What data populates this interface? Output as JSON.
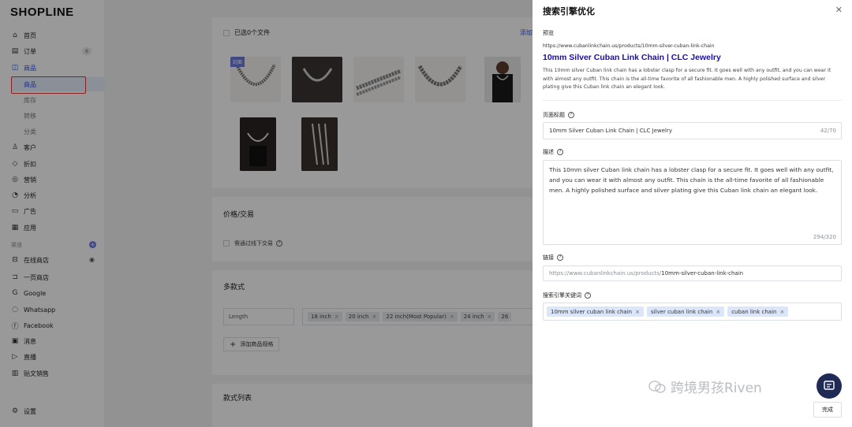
{
  "logo": "SHOPLINE",
  "sidebar": {
    "items": [
      {
        "label": "首页",
        "icon": "home-icon"
      },
      {
        "label": "订单",
        "icon": "order-icon",
        "badge": "6"
      },
      {
        "label": "商品",
        "icon": "bag-icon"
      },
      {
        "label": "商品",
        "icon": ""
      },
      {
        "label": "库存",
        "icon": ""
      },
      {
        "label": "转移",
        "icon": ""
      },
      {
        "label": "分类",
        "icon": ""
      },
      {
        "label": "客户",
        "icon": "user-icon"
      },
      {
        "label": "折扣",
        "icon": "tag-icon"
      },
      {
        "label": "营销",
        "icon": "marketing-icon"
      },
      {
        "label": "分析",
        "icon": "analytics-icon"
      },
      {
        "label": "广告",
        "icon": "ads-icon"
      },
      {
        "label": "应用",
        "icon": "apps-icon"
      }
    ],
    "channels_label": "渠道",
    "channels": [
      {
        "label": "在线商店",
        "icon": "store-icon"
      },
      {
        "label": "一页商店",
        "icon": "page-store-icon"
      },
      {
        "label": "Google",
        "icon": "google-icon"
      },
      {
        "label": "Whatsapp",
        "icon": "whatsapp-icon"
      },
      {
        "label": "Facebook",
        "icon": "facebook-icon"
      },
      {
        "label": "消息",
        "icon": "message-icon"
      },
      {
        "label": "直播",
        "icon": "live-icon"
      },
      {
        "label": "贴文销售",
        "icon": "post-sale-icon"
      }
    ],
    "settings": "设置"
  },
  "main": {
    "files_selected": "已选0个文件",
    "add_link": "添加",
    "cover_tag": "封面",
    "pricing_title": "价格/交易",
    "offline_trade": "需通过线下交易",
    "variants_title": "多款式",
    "option_name": "Length",
    "option_values": [
      "18 inch",
      "20 inch",
      "22 inch(Most Popular)",
      "24 inch",
      "26"
    ],
    "add_spec": "添加商品规格",
    "variant_list_title": "款式列表"
  },
  "seo": {
    "title": "搜索引擎优化",
    "preview_label": "预览",
    "preview_url": "https://www.cubanlinkchain.us/products/10mm-silver-cuban-link-chain",
    "preview_title": "10mm Silver Cuban Link Chain | CLC Jewelry",
    "preview_desc": "This 10mm silver Cuban link chain has a lobster clasp for a secure fit. It goes well with any outfit, and you can wear it with almost any outfit. This chain is the all-time favorite of all fashionable men. A highly polished surface and silver plating give this Cuban link chain an elegant look.",
    "page_title_label": "页面标题",
    "page_title_value": "10mm Silver Cuban Link Chain | CLC Jewelry",
    "page_title_count": "42/70",
    "desc_label": "描述",
    "desc_value": "This 10mm silver Cuban link chain has a lobster clasp for a secure fit. It goes well with any outfit, and you can wear it with almost any outfit. This chain is the all-time favorite of all fashionable men. A highly polished surface and silver plating give this Cuban link chain an elegant look.",
    "desc_count": "294/320",
    "link_label": "链接",
    "link_prefix": "https://www.cubanlinkchain.us/products/",
    "link_value": "10mm-silver-cuban-link-chain",
    "keywords_label": "搜索引擎关键词",
    "keywords": [
      "10mm silver cuban link chain",
      "silver cuban link chain",
      "cuban link chain"
    ],
    "done": "完成"
  },
  "watermark": "跨境男孩Riven"
}
